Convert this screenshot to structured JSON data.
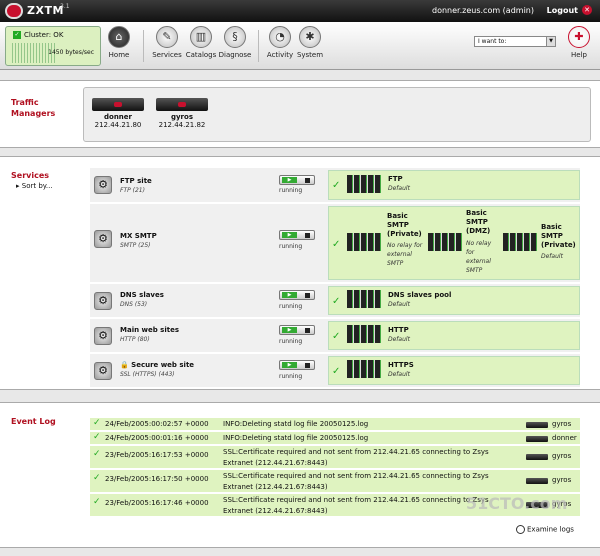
{
  "app": {
    "name": "ZXTM",
    "version": "3.1",
    "user": "donner.zeus.com (admin)",
    "logout": "Logout"
  },
  "cluster": {
    "status": "Cluster: OK",
    "rate": "1450 bytes/sec"
  },
  "toolbar": {
    "home": "Home",
    "services": "Services",
    "catalogs": "Catalogs",
    "diagnose": "Diagnose",
    "activity": "Activity",
    "system": "System",
    "help": "Help",
    "iwant": "I want to:"
  },
  "sections": {
    "traffic": "Traffic Managers",
    "services": "Services",
    "sortby": "Sort by...",
    "eventlog": "Event Log"
  },
  "traffic_managers": [
    {
      "name": "donner",
      "ip": "212.44.21.80"
    },
    {
      "name": "gyros",
      "ip": "212.44.21.82"
    }
  ],
  "services": [
    {
      "name": "FTP site",
      "proto": "FTP (21)",
      "state": "running",
      "pools": [
        {
          "name": "FTP",
          "desc": "Default"
        }
      ]
    },
    {
      "name": "MX SMTP",
      "proto": "SMTP (25)",
      "state": "running",
      "pools": [
        {
          "name": "Basic SMTP (Private)",
          "desc": "No relay for external SMTP"
        },
        {
          "name": "Basic SMTP (DMZ)",
          "desc": "No relay for external SMTP"
        },
        {
          "name": "Basic SMTP (Private)",
          "desc": "Default"
        }
      ]
    },
    {
      "name": "DNS slaves",
      "proto": "DNS (53)",
      "state": "running",
      "pools": [
        {
          "name": "DNS slaves pool",
          "desc": "Default"
        }
      ]
    },
    {
      "name": "Main web sites",
      "proto": "HTTP (80)",
      "state": "running",
      "pools": [
        {
          "name": "HTTP",
          "desc": "Default"
        }
      ]
    },
    {
      "name": "Secure web site",
      "proto": "SSL (HTTPS) (443)",
      "state": "running",
      "pools": [
        {
          "name": "HTTPS",
          "desc": "Default"
        }
      ]
    }
  ],
  "events": [
    {
      "date": "24/Feb/2005:00:02:57 +0000",
      "msg": "INFO:Deleting statd log file 20050125.log",
      "host": "gyros"
    },
    {
      "date": "24/Feb/2005:00:01:16 +0000",
      "msg": "INFO:Deleting statd log file 20050125.log",
      "host": "donner"
    },
    {
      "date": "23/Feb/2005:16:17:53 +0000",
      "msg": "SSL:Certificate required and not sent from 212.44.21.65 connecting to Zsys Extranet (212.44.21.67:8443)",
      "host": "gyros"
    },
    {
      "date": "23/Feb/2005:16:17:50 +0000",
      "msg": "SSL:Certificate required and not sent from 212.44.21.65 connecting to Zsys Extranet (212.44.21.67:8443)",
      "host": "gyros"
    },
    {
      "date": "23/Feb/2005:16:17:46 +0000",
      "msg": "SSL:Certificate required and not sent from 212.44.21.65 connecting to Zsys Extranet (212.44.21.67:8443)",
      "host": "gyros"
    }
  ],
  "examine": "Examine logs",
  "watermark": "51CTO.com"
}
